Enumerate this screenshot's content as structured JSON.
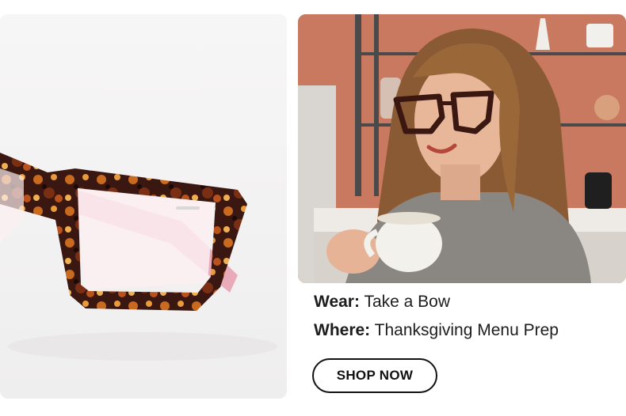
{
  "product_image": {
    "icon": "tortoiseshell-glasses-image",
    "frame_color": "#3a1710",
    "temple_color": "#e8a3b2"
  },
  "lifestyle_image": {
    "icon": "woman-wearing-glasses-photo",
    "wall_color": "#c9795f"
  },
  "caption": {
    "wear_label": "Wear:",
    "wear_value": "Take a Bow",
    "where_label": "Where:",
    "where_value": "Thanksgiving Menu Prep"
  },
  "cta": {
    "label": "SHOP NOW"
  }
}
